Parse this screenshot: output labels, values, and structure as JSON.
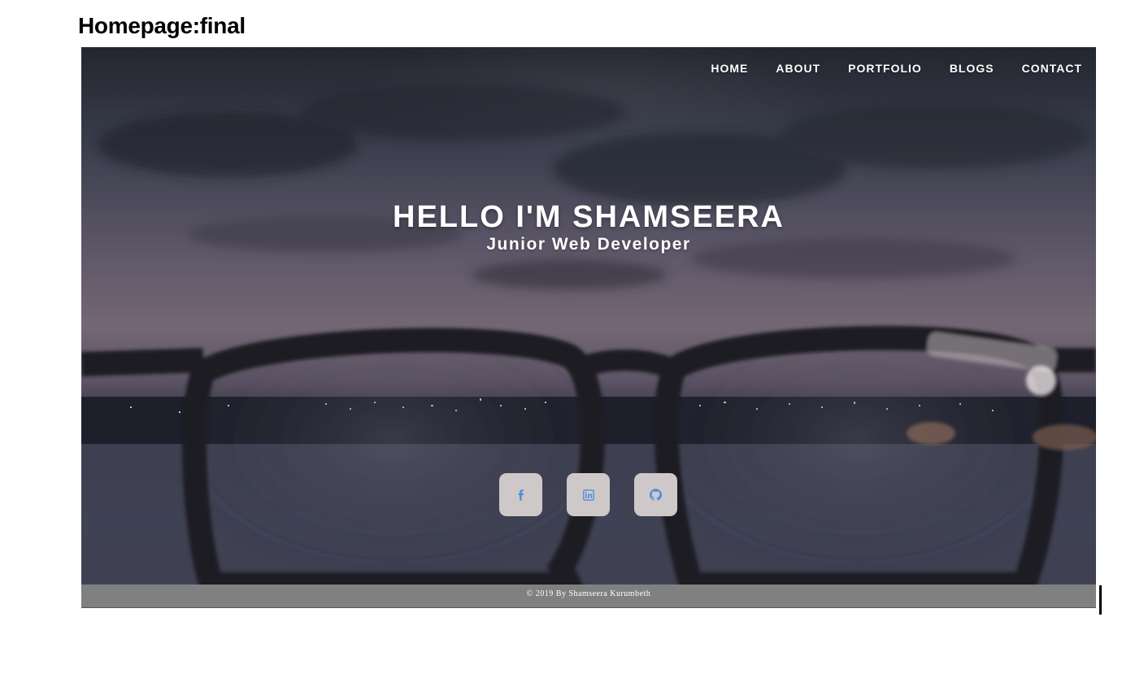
{
  "page": {
    "title": "Homepage:final"
  },
  "nav": {
    "items": [
      {
        "label": "HOME"
      },
      {
        "label": "ABOUT"
      },
      {
        "label": "PORTFOLIO"
      },
      {
        "label": "BLOGS"
      },
      {
        "label": "CONTACT"
      }
    ]
  },
  "hero": {
    "headline": "HELLO I'M SHAMSEERA",
    "subheadline": "Junior Web Developer"
  },
  "social": {
    "buttons": [
      {
        "icon": "facebook-icon"
      },
      {
        "icon": "linkedin-icon"
      },
      {
        "icon": "github-icon"
      }
    ],
    "icon_color": "#4a90d9",
    "button_color": "#cfc8c9"
  },
  "footer": {
    "text": "© 2019 By Shamseera Kurumbeth"
  }
}
